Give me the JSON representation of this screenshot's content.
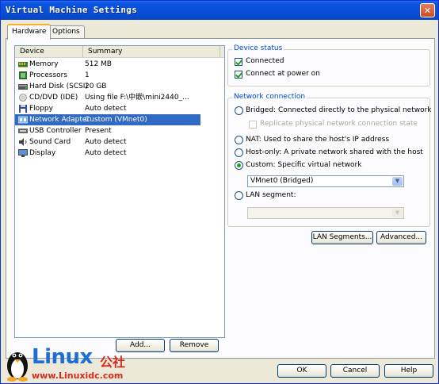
{
  "window": {
    "title": "Virtual Machine Settings",
    "close_glyph": "✕"
  },
  "tabs": [
    {
      "label": "Hardware"
    },
    {
      "label": "Options"
    }
  ],
  "device_list": {
    "headers": {
      "device": "Device",
      "summary": "Summary"
    },
    "rows": [
      {
        "name": "Memory",
        "summary": "512 MB",
        "icon": "memory-icon"
      },
      {
        "name": "Processors",
        "summary": "1",
        "icon": "processor-icon"
      },
      {
        "name": "Hard Disk (SCSI)",
        "summary": "20 GB",
        "icon": "hard-disk-icon"
      },
      {
        "name": "CD/DVD (IDE)",
        "summary": "Using file F:\\中嵌\\mini2440_...",
        "icon": "cd-dvd-icon"
      },
      {
        "name": "Floppy",
        "summary": "Auto detect",
        "icon": "floppy-icon"
      },
      {
        "name": "Network Adapter",
        "summary": "Custom (VMnet0)",
        "icon": "network-adapter-icon",
        "selected": true
      },
      {
        "name": "USB Controller",
        "summary": "Present",
        "icon": "usb-icon"
      },
      {
        "name": "Sound Card",
        "summary": "Auto detect",
        "icon": "sound-card-icon"
      },
      {
        "name": "Display",
        "summary": "Auto detect",
        "icon": "display-icon"
      }
    ],
    "add_label": "Add...",
    "remove_label": "Remove"
  },
  "device_status": {
    "title": "Device status",
    "connected_label": "Connected",
    "connected": true,
    "connect_at_power_on_label": "Connect at power on",
    "connect_at_power_on": true
  },
  "network_connection": {
    "title": "Network connection",
    "bridged_label": "Bridged: Connected directly to the physical network",
    "replicate_label": "Replicate physical network connection state",
    "nat_label": "NAT: Used to share the host's IP address",
    "host_only_label": "Host-only: A private network shared with the host",
    "custom_label": "Custom: Specific virtual network",
    "selected": "custom",
    "custom_value": "VMnet0 (Bridged)",
    "lan_segment_label": "LAN segment:",
    "lan_segment_value": "",
    "lan_segments_button": "LAN Segments...",
    "advanced_button": "Advanced..."
  },
  "footer": {
    "ok": "OK",
    "cancel": "Cancel",
    "help": "Help"
  },
  "watermark": {
    "brand": "Linux",
    "brand_suffix": "公社",
    "url": "www.Linuxidc.com"
  },
  "colors": {
    "selection": "#316ac5",
    "title_bar": "#0a54e0",
    "group_title": "#0046d5",
    "check_green": "#21a121"
  }
}
